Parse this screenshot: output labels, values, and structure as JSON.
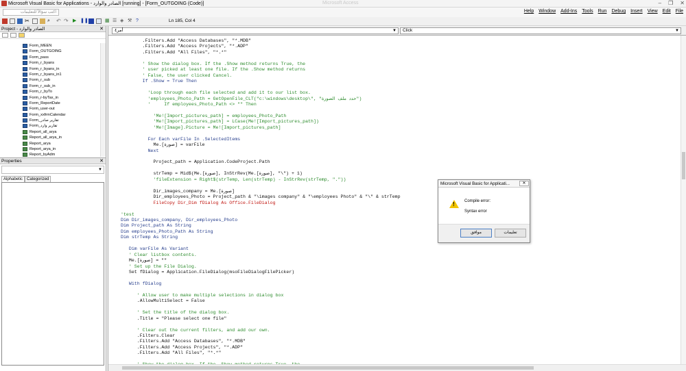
{
  "window": {
    "title": "Microsoft Visual Basic for Applications - الصادر والوارد [running] - [Form_OUTGOING (Code)]",
    "ghost_title": "Microsoft Access",
    "controls": [
      "–",
      "❐",
      "✕"
    ]
  },
  "menubar": {
    "ask_placeholder": "اكتب سؤالاً للتعليمات",
    "items": [
      "Help",
      "Window",
      "Add-Ins",
      "Tools",
      "Run",
      "Debug",
      "Insert",
      "View",
      "Edit",
      "File"
    ]
  },
  "toolbar": {
    "position": "Ln 185, Col 4"
  },
  "project": {
    "title": "Project - الصادر والوارد",
    "items": [
      {
        "name": "Form_MEEN",
        "kind": "form"
      },
      {
        "name": "Form_OUTGOING",
        "kind": "form"
      },
      {
        "name": "Form_pass",
        "kind": "form"
      },
      {
        "name": "Form_r_byans",
        "kind": "form"
      },
      {
        "name": "Form_r_byans_in",
        "kind": "form"
      },
      {
        "name": "Form_r_byans_in1",
        "kind": "form"
      },
      {
        "name": "Form_r_sub",
        "kind": "form"
      },
      {
        "name": "Form_r_sub_in",
        "kind": "form"
      },
      {
        "name": "Form_r_byTo",
        "kind": "form"
      },
      {
        "name": "Form_r-byTax_in",
        "kind": "form"
      },
      {
        "name": "Form_ReportDate",
        "kind": "form"
      },
      {
        "name": "Form_user-out",
        "kind": "form"
      },
      {
        "name": "Form_xxfrmCalendar",
        "kind": "form"
      },
      {
        "name": "Form_تقارير صادر",
        "kind": "form"
      },
      {
        "name": "Form_تقارير وارد",
        "kind": "form"
      },
      {
        "name": "Report_all_arya",
        "kind": "report"
      },
      {
        "name": "Report_all_arya_in",
        "kind": "report"
      },
      {
        "name": "Report_arya",
        "kind": "report"
      },
      {
        "name": "Report_arya_in",
        "kind": "report"
      },
      {
        "name": "Report_byAdm",
        "kind": "report"
      }
    ]
  },
  "properties": {
    "title": "Properties",
    "tabs": [
      "Alphabetic",
      "Categorized"
    ]
  },
  "code_window": {
    "object_combo": "أمر٤",
    "proc_combo": "Click",
    "lines": [
      {
        "t": "        .Filters.Add \"Access Databases\", \"*.MDB\"",
        "c": "black"
      },
      {
        "t": "        .Filters.Add \"Access Projects\", \"*.ADP\"",
        "c": "black"
      },
      {
        "t": "        .Filters.Add \"All Files\", \"*.*\"",
        "c": "black"
      },
      {
        "t": "",
        "c": "black"
      },
      {
        "t": "        ' Show the dialog box. If the .Show method returns True, the",
        "c": "green"
      },
      {
        "t": "        ' user picked at least one file. If the .Show method returns",
        "c": "green"
      },
      {
        "t": "        ' False, the user clicked Cancel.",
        "c": "green"
      },
      {
        "t": "        If .Show = True Then",
        "c": "navy"
      },
      {
        "t": "",
        "c": "black"
      },
      {
        "t": "          'Loop through each file selected and add it to our list box.",
        "c": "green"
      },
      {
        "t": "          'employees_Photo_Path = GetOpenFile_CLT(\"c:\\windows\\desktop\\\", \"حدد ملف الصورة\")",
        "c": "green"
      },
      {
        "t": "          '     If employees_Photo_Path <> \"\" Then",
        "c": "green"
      },
      {
        "t": "",
        "c": "black"
      },
      {
        "t": "            'Me![Import_pictures_path] = employees_Photo_Path",
        "c": "green"
      },
      {
        "t": "            'Me![Import_pictures_path] = LCase(Me![Import_pictures_path])",
        "c": "green"
      },
      {
        "t": "            'Me![Image].Picture = Me![Import_pictures_path]",
        "c": "green"
      },
      {
        "t": "",
        "c": "black"
      },
      {
        "t": "          For Each varFile In .SelectedItems",
        "c": "navy"
      },
      {
        "t": "            Me.[صورة] = varFile",
        "c": "black"
      },
      {
        "t": "          Next",
        "c": "navy"
      },
      {
        "t": "",
        "c": "black"
      },
      {
        "t": "            Project_path = Application.CodeProject.Path",
        "c": "black"
      },
      {
        "t": "",
        "c": "black"
      },
      {
        "t": "            strTemp = Mid$(Me.[صورة], InStrRev(Me.[صورة], \"\\\") + 1)",
        "c": "black"
      },
      {
        "t": "            'fileExtension = Right$(strTemp, Len(strTemp) - InStrRev(strTemp, \".\"))",
        "c": "green"
      },
      {
        "t": "",
        "c": "black"
      },
      {
        "t": "            Dir_images_company = Me.[صورة]",
        "c": "black"
      },
      {
        "t": "            Dir_employees_Photo = Project_path & \"\\images company\" & \"\\employees Photo\" & \"\\\" & strTemp",
        "c": "black"
      },
      {
        "t": "            FileCopy Dir_Dim fDialog As Office.FileDialog",
        "c": "red"
      },
      {
        "t": "",
        "c": "black"
      },
      {
        "t": "'test",
        "c": "green"
      },
      {
        "t": "Dim Dir_images_company, Dir_employees_Photo",
        "c": "navy"
      },
      {
        "t": "Dim Project_path As String",
        "c": "navy"
      },
      {
        "t": "Dim employees_Photo_Path As String",
        "c": "navy"
      },
      {
        "t": "Dim strTemp As String",
        "c": "navy"
      },
      {
        "t": "",
        "c": "black"
      },
      {
        "t": "   Dim varFile As Variant",
        "c": "navy"
      },
      {
        "t": "   ' Clear listbox contents.",
        "c": "green"
      },
      {
        "t": "   Me.[صورة] = \"\"",
        "c": "black"
      },
      {
        "t": "   ' Set up the File Dialog.",
        "c": "green"
      },
      {
        "t": "   Set fDialog = Application.FileDialog(msoFileDialogFilePicker)",
        "c": "black"
      },
      {
        "t": "",
        "c": "black"
      },
      {
        "t": "   With fDialog",
        "c": "navy"
      },
      {
        "t": "",
        "c": "black"
      },
      {
        "t": "      ' Allow user to make multiple selections in dialog box",
        "c": "green"
      },
      {
        "t": "      .AllowMultiSelect = False",
        "c": "black"
      },
      {
        "t": "",
        "c": "black"
      },
      {
        "t": "      ' Set the title of the dialog box.",
        "c": "green"
      },
      {
        "t": "      .Title = \"Please select one file\"",
        "c": "black"
      },
      {
        "t": "",
        "c": "black"
      },
      {
        "t": "      ' Clear out the current filters, and add our own.",
        "c": "green"
      },
      {
        "t": "      .Filters.Clear",
        "c": "black"
      },
      {
        "t": "      .Filters.Add \"Access Databases\", \"*.MDB\"",
        "c": "black"
      },
      {
        "t": "      .Filters.Add \"Access Projects\", \"*.ADP\"",
        "c": "black"
      },
      {
        "t": "      .Filters.Add \"All Files\", \"*.*\"",
        "c": "black"
      },
      {
        "t": "",
        "c": "black"
      },
      {
        "t": "      ' Show the dialog box. If the .Show method returns True, the",
        "c": "green"
      }
    ]
  },
  "dialog": {
    "title": "Microsoft Visual Basic for Applicati...",
    "close_label": "✕",
    "message": "Compile error:",
    "detail": "Syntax error",
    "ok_label": "موافق",
    "help_label": "تعليمات"
  }
}
